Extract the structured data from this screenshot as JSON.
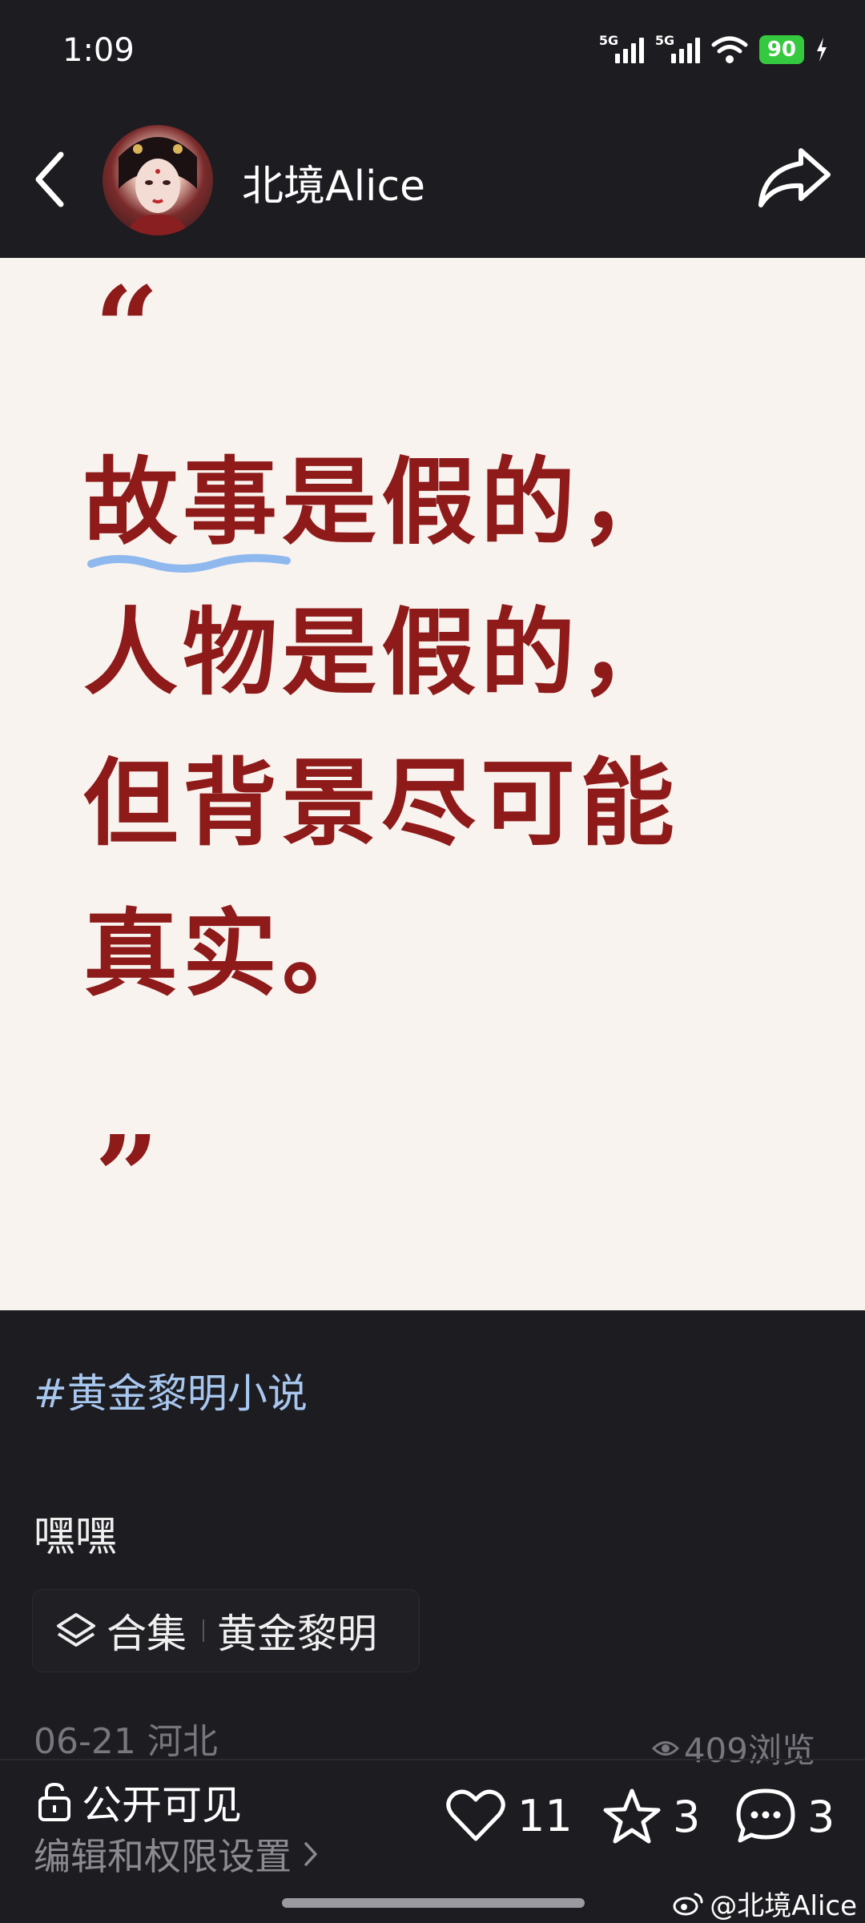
{
  "status_bar": {
    "time": "1:09",
    "network_1": "5G",
    "network_2": "5G",
    "battery": "90"
  },
  "header": {
    "user_name": "北境Alice"
  },
  "quote_card": {
    "open_mark": "“",
    "close_mark": "”",
    "lines": [
      "故事是假的，",
      "人物是假的，",
      "但背景尽可能",
      "真实。"
    ],
    "text_color": "#8e1a1a",
    "background": "#f8f3ee",
    "underline_color": "#8fb8ee"
  },
  "post": {
    "hashtag": "#黄金黎明小说",
    "text": "嘿嘿",
    "collection_label": "合集",
    "collection_name": "黄金黎明",
    "date_location": "06-21 河北",
    "views": "409浏览"
  },
  "bottom_bar": {
    "visibility": "公开可见",
    "edit_permissions": "编辑和权限设置",
    "likes": "11",
    "favorites": "3",
    "comments": "3"
  },
  "watermark": "@北境Alice"
}
